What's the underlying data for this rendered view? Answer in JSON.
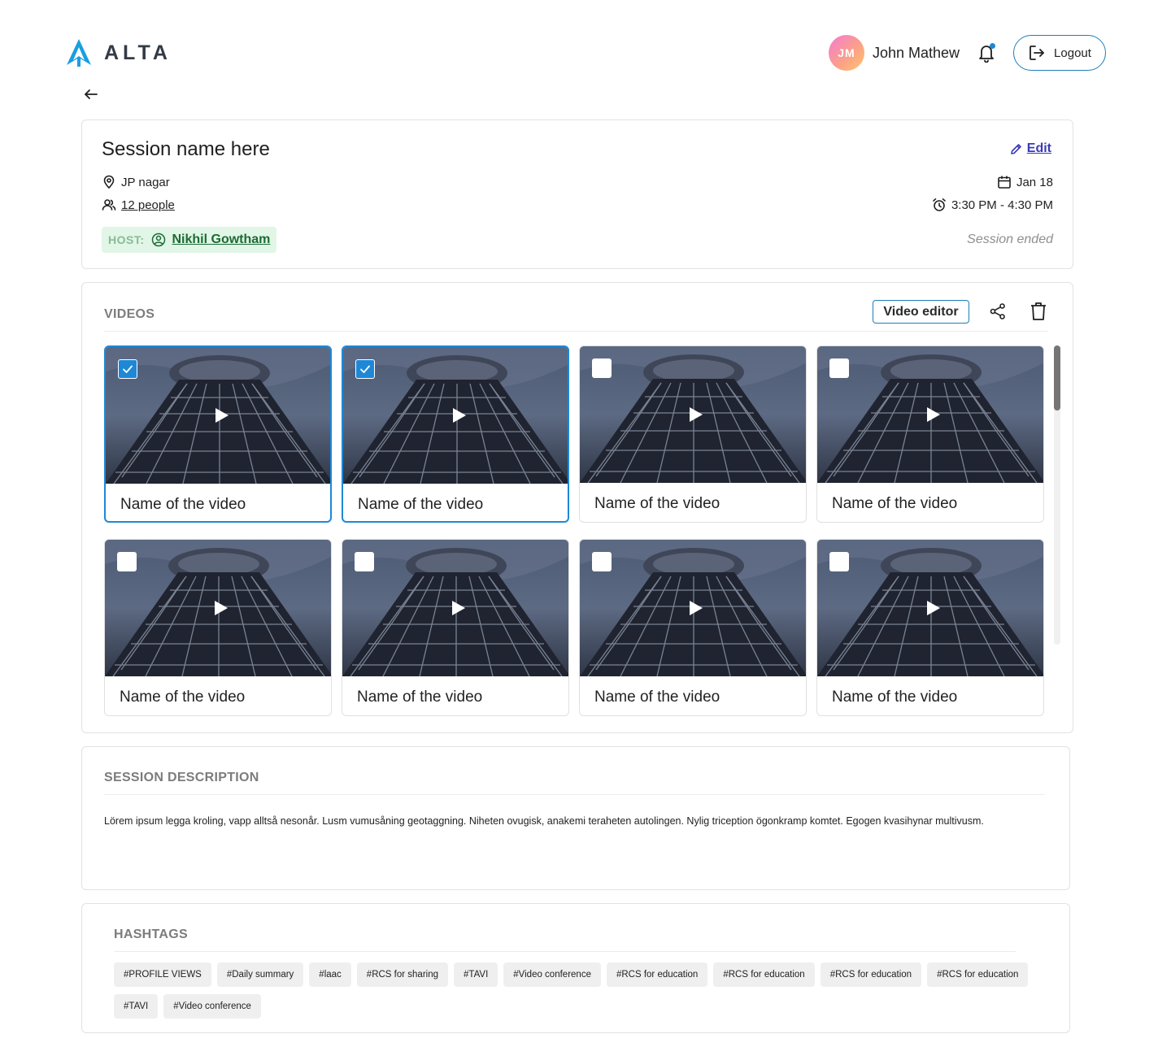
{
  "header": {
    "logo_text": "ALTA",
    "user_initials": "JM",
    "user_name": "John Mathew",
    "logout_label": "Logout"
  },
  "session": {
    "title": "Session name here",
    "edit_label": "Edit",
    "location": "JP nagar",
    "people": "12 people",
    "date": "Jan 18",
    "time": "3:30 PM - 4:30 PM",
    "host_label": "HOST:",
    "host_name": "Nikhil Gowtham",
    "status": "Session ended"
  },
  "videos": {
    "heading": "VIDEOS",
    "editor_label": "Video editor",
    "items": [
      {
        "name": "Name of the video",
        "selected": true
      },
      {
        "name": "Name of the video",
        "selected": true
      },
      {
        "name": "Name of the video",
        "selected": false
      },
      {
        "name": "Name of the video",
        "selected": false
      },
      {
        "name": "Name of the video",
        "selected": false
      },
      {
        "name": "Name of the video",
        "selected": false
      },
      {
        "name": "Name of the video",
        "selected": false
      },
      {
        "name": "Name of the video",
        "selected": false
      }
    ]
  },
  "description": {
    "heading": "SESSION DESCRIPTION",
    "text": "Lörem ipsum legga kroling, vapp alltså nesonår. Lusm vumusåning geotaggning. Niheten ovugisk, anakemi teraheten autolingen. Nylig triception ögonkramp komtet. Egogen kvasihynar multivusm."
  },
  "hashtags": {
    "heading": "HASHTAGS",
    "items": [
      "#PROFILE VIEWS",
      "#Daily summary",
      "#laac",
      "#RCS for sharing",
      "#TAVI",
      "#Video conference",
      "#RCS for education",
      "#RCS for education",
      "#RCS for education",
      "#RCS for education",
      "#TAVI",
      "#Video conference"
    ]
  },
  "colors": {
    "accent": "#1e88d7",
    "logo": "#1a9fe0",
    "host_bg": "#e1f6e6",
    "host_text": "#1c6b35",
    "edit_link": "#3a3ab8"
  }
}
